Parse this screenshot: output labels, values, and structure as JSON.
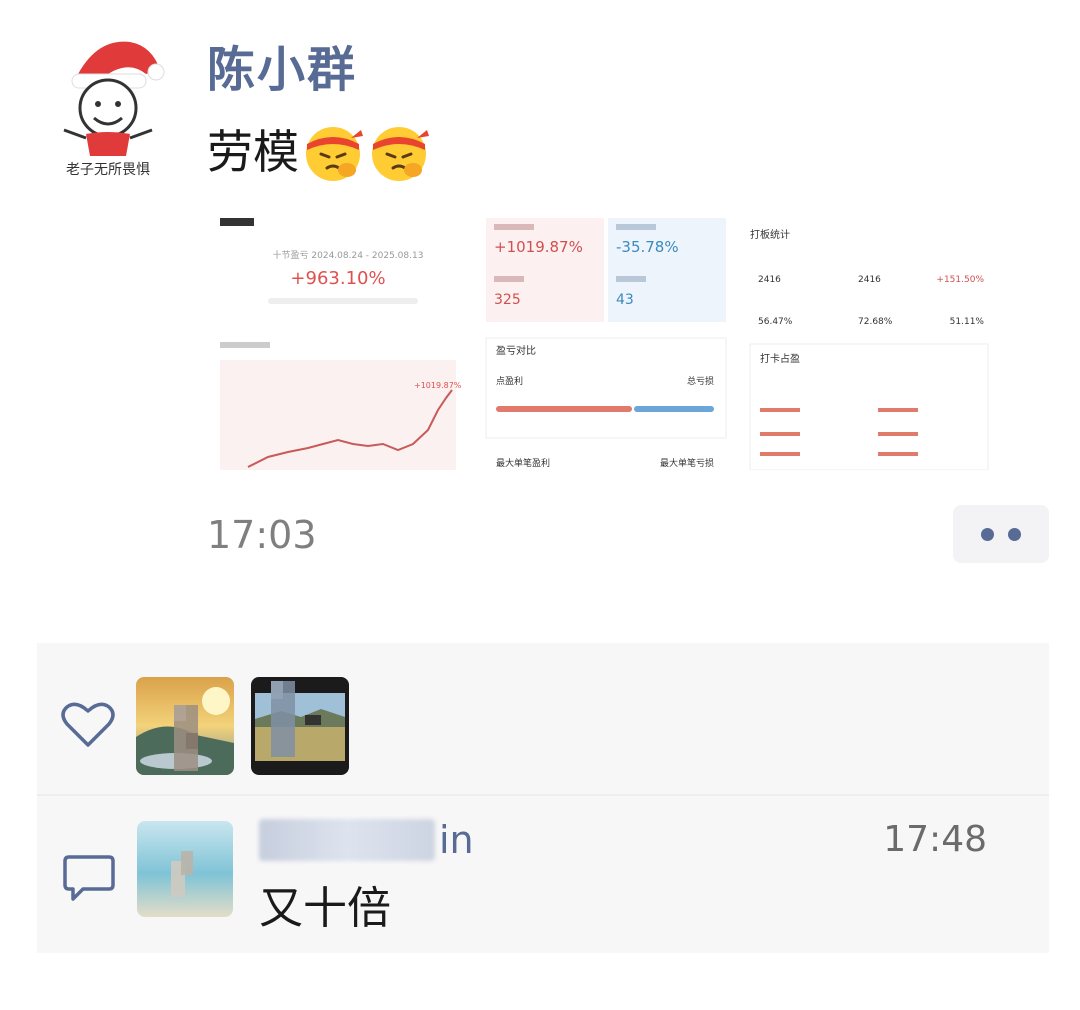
{
  "post": {
    "author": "陈小群",
    "avatar_caption": "老子无所畏惧",
    "text": "劳模",
    "emoji": "salute-emoji",
    "time": "17:03",
    "more_icon": "more-dots-icon"
  },
  "screenshot": {
    "left": {
      "range_label": "十节盈亏 2024.08.24 - 2025.08.13",
      "total_return": "+963.10%"
    },
    "stats": {
      "top_left": "+1019.87%",
      "top_right": "-35.78%",
      "bottom_left": "325",
      "bottom_right": "43"
    },
    "right": {
      "title": "打板统计",
      "row1": [
        "2416",
        "2416",
        "+151.50%"
      ],
      "row2": [
        "56.47%",
        "72.68%",
        "51.11%"
      ],
      "box_title": "打卡占盈"
    },
    "chart_annotation": "+1019.87%",
    "compare_title": "盈亏对比",
    "compare_left": "点盈利",
    "compare_right": "总亏损",
    "max_left": "最大单笔盈利",
    "max_right": "最大单笔亏损"
  },
  "interactions": {
    "like_icon": "heart-icon",
    "comment_icon": "comment-icon",
    "comment": {
      "name_suffix": "in",
      "time": "17:48",
      "text": "又十倍"
    }
  }
}
